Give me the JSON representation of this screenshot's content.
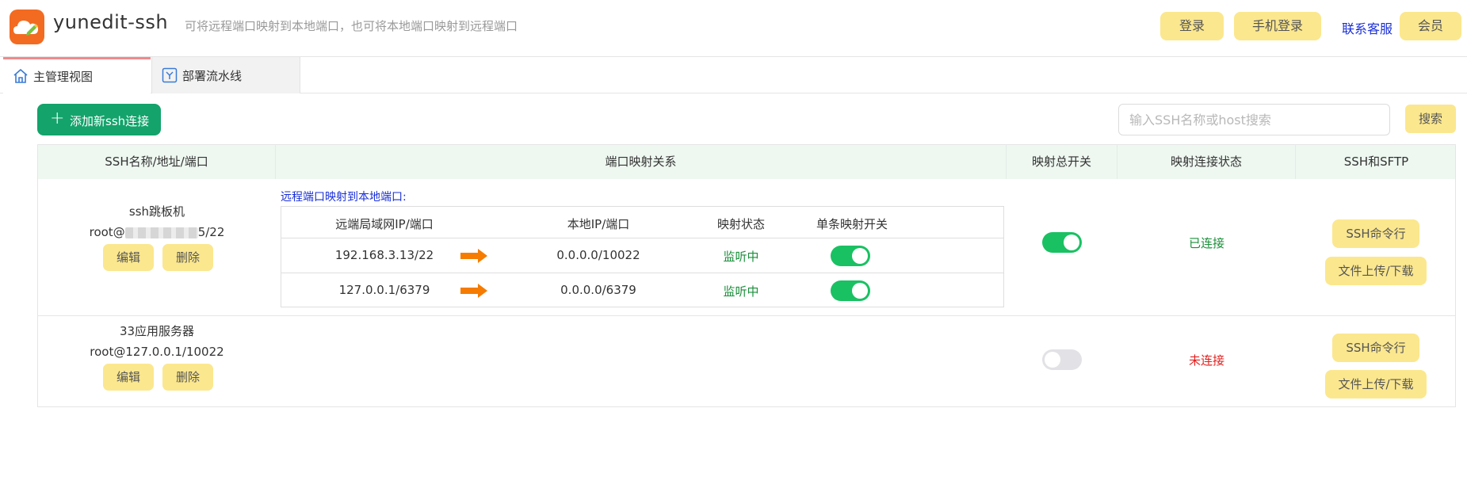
{
  "header": {
    "app_title": "yunedit-ssh",
    "subtitle": "可将远程端口映射到本地端口，也可将本地端口映射到远程端口",
    "login_label": "登录",
    "phone_login_label": "手机登录",
    "support_label": "联系客服",
    "vip_label": "会员"
  },
  "tabs": [
    {
      "label": "主管理视图",
      "active": true
    },
    {
      "label": "部署流水线",
      "active": false
    }
  ],
  "toolbar": {
    "add_label": "添加新ssh连接",
    "search_placeholder": "输入SSH名称或host搜索",
    "search_value": "",
    "search_label": "搜索"
  },
  "table": {
    "headers": [
      "SSH名称/地址/端口",
      "端口映射关系",
      "映射总开关",
      "映射连接状态",
      "SSH和SFTP"
    ],
    "mapping_title": "远程端口映射到本地端口:",
    "mapping_headers": [
      "远端局域网IP/端口",
      "本地IP/端口",
      "映射状态",
      "单条映射开关"
    ],
    "rows": [
      {
        "name": "ssh跳板机",
        "addr_prefix": "root@",
        "addr_suffix": "5/22",
        "edit_label": "编辑",
        "delete_label": "删除",
        "mappings": [
          {
            "remote": "192.168.3.13/22",
            "local": "0.0.0.0/10022",
            "state": "监听中",
            "enabled": true
          },
          {
            "remote": "127.0.0.1/6379",
            "local": "0.0.0.0/6379",
            "state": "监听中",
            "enabled": true
          }
        ],
        "master_switch": true,
        "conn_status": "已连接",
        "ssh_label": "SSH命令行",
        "sftp_label": "文件上传/下载"
      },
      {
        "name": "33应用服务器",
        "addr": "root@127.0.0.1/10022",
        "edit_label": "编辑",
        "delete_label": "删除",
        "master_switch": false,
        "conn_status": "未连接",
        "ssh_label": "SSH命令行",
        "sftp_label": "文件上传/下载"
      }
    ]
  },
  "colors": {
    "accent_green": "#13a36b",
    "button_yellow": "#fbe78e",
    "header_bg": "#eef8f1",
    "toggle_on": "#19c162",
    "status_ok": "#1a8f3a",
    "status_bad": "#e0201e",
    "link_blue": "#1a2fd6"
  },
  "icons": {
    "logo": "cloud-pencil-logo-icon",
    "tab_home": "home-icon",
    "tab_pipeline": "pipeline-check-icon",
    "add": "plus-icon",
    "mapping_arrow": "arrow-right-icon"
  }
}
